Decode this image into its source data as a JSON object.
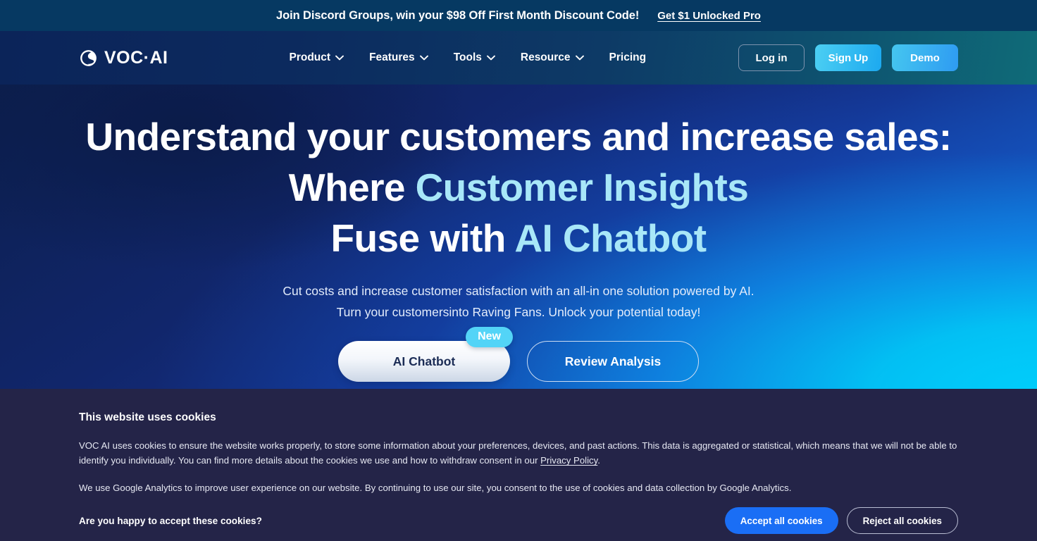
{
  "announcement": {
    "text": "Join Discord Groups, win your $98 Off First Month Discount Code!",
    "link_label": "Get $1 Unlocked Pro",
    "bg_color": "#063962"
  },
  "header": {
    "logo_text": "VOC·AI",
    "logo_icon": "globe-swoosh-icon",
    "nav": [
      {
        "label": "Product",
        "has_dropdown": true
      },
      {
        "label": "Features",
        "has_dropdown": true
      },
      {
        "label": "Tools",
        "has_dropdown": true
      },
      {
        "label": "Resource",
        "has_dropdown": true
      },
      {
        "label": "Pricing",
        "has_dropdown": false
      }
    ],
    "login_label": "Log in",
    "signup_label": "Sign Up",
    "demo_label": "Demo",
    "accent_color": "#2e9bf2"
  },
  "hero": {
    "headline_line1": "Understand your customers and increase sales:",
    "headline_line2_plain": "Where ",
    "headline_line2_accent": "Customer Insights",
    "headline_line3_plain": "Fuse with ",
    "headline_line3_accent": "AI Chatbot",
    "accent_color": "#a8e7f8",
    "subtitle_line1": "Cut costs and increase customer satisfaction with an all-in one solution powered by AI.",
    "subtitle_line2": "Turn your customersinto Raving Fans. Unlock your potential today!",
    "cta_primary_label": "AI Chatbot",
    "cta_primary_badge": "New",
    "cta_secondary_label": "Review Analysis"
  },
  "cookie_banner": {
    "title": "This website uses cookies",
    "paragraph1_before_link": "VOC AI uses cookies to ensure the website works properly, to store some information about your preferences, devices, and past actions. This data is aggregated or statistical, which means that we will not be able to identify you individually. You can find more details about the cookies we use and how to withdraw consent in our ",
    "paragraph1_link": "Privacy Policy",
    "paragraph1_after_link": ".",
    "paragraph2": "We use Google Analytics to improve user experience on our website. By continuing to use our site, you consent to the use of cookies and data collection by Google Analytics.",
    "question": "Are you happy to accept these cookies?",
    "accept_label": "Accept all cookies",
    "reject_label": "Reject all cookies",
    "bg_color": "#242448",
    "accept_color": "#1a6ef5"
  }
}
